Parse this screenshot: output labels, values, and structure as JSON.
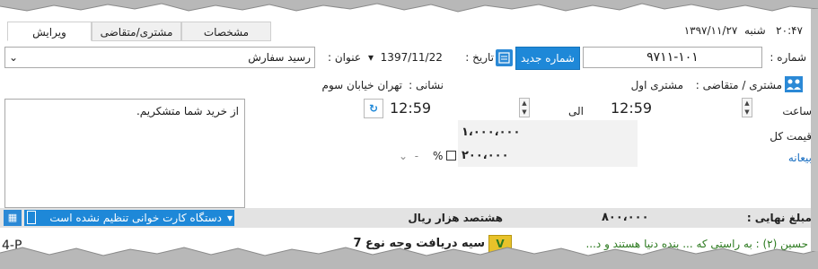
{
  "header": {
    "clock": "۲۰:۴۷",
    "weekday": "شنبه",
    "date": "۱۳۹۷/۱۱/۲۷"
  },
  "tabs": [
    {
      "label": "ویرایش",
      "active": true
    },
    {
      "label": "مشتری/متقاضی",
      "active": false
    },
    {
      "label": "مشخصات",
      "active": false
    }
  ],
  "form": {
    "number_label": "شماره :",
    "number_value": "۹۷۱۱-۱۰۱",
    "new_number_button": "شماره جدید",
    "date_label": "تاریخ :",
    "date_value": "1397/11/22",
    "title_label": "عنوان :",
    "title_value": "رسید سفارش",
    "customer_label": "مشتری / متقاضی :",
    "customer_value": "مشتری اول",
    "address_label": "نشانی :",
    "address_value": "تهران خیابان سوم",
    "time_label": "ساعت",
    "time_from": "12:59",
    "to_label": "الی",
    "time_to": "12:59",
    "price_label": "قیمت کل",
    "price_value": "۱،۰۰۰،۰۰۰",
    "deposit_label": "بیعانه",
    "deposit_value": "۲۰۰،۰۰۰",
    "percent_symbol": "%",
    "percent_option": "-",
    "notes": "از خرید شما متشکریم."
  },
  "footer": {
    "final_label": "مبلغ نهایی :",
    "final_value": "۸۰۰،۰۰۰",
    "words": "هشتصد  هزار  ریال",
    "card_reader": "دستگاه کارت خوانی تنظیم نشده است",
    "bottom_left": "4-P",
    "bottom_tail": "سیه دریافت وجه نوع 7",
    "bottom_right": "حسین (۲) : به راستی که ... بنده دنیا هستند و د..."
  },
  "colors": {
    "accent": "#1e88d8",
    "link": "#1a6fc2"
  },
  "icons": [
    "calculator-icon",
    "customer-group-icon",
    "refresh-icon",
    "chevron-down-icon",
    "card-reader-icon",
    "grid-icon"
  ]
}
